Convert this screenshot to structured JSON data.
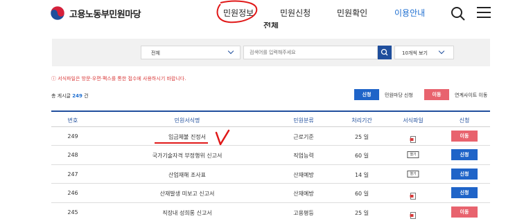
{
  "header": {
    "logo_text": "고용노동부민원마당",
    "nav": [
      {
        "label": "민원정보"
      },
      {
        "label": "민원신청"
      },
      {
        "label": "민원확인"
      },
      {
        "label": "이용안내"
      }
    ],
    "page_title_peek": "전체"
  },
  "search": {
    "scope_value": "전체",
    "placeholder": "검색어를 입력해주세요",
    "count_value": "10개씩 보기"
  },
  "notice": "ⓘ 서식파일은 방문·우편·팩스를 통한 접수에 사용하시기 바랍니다.",
  "total": {
    "prefix": "총 게시글",
    "count": "249",
    "suffix": "건"
  },
  "legend": {
    "apply_btn": "신청",
    "apply_text": "민원마당 신청",
    "move_btn": "이동",
    "move_text": "연계사이트 이동"
  },
  "table": {
    "headers": [
      "번호",
      "민원서식명",
      "민원분류",
      "처리기간",
      "서식파일",
      "신청"
    ],
    "rows": [
      {
        "no": "249",
        "name": "임금체불 진정서",
        "category": "근로기준",
        "period": "25 일",
        "file": "icon",
        "action": "이동",
        "action_type": "red"
      },
      {
        "no": "248",
        "name": "국가기술자격 부정행위 신고서",
        "category": "직업능력",
        "period": "60 일",
        "file": "열기",
        "action": "신청",
        "action_type": "blue"
      },
      {
        "no": "247",
        "name": "산업재해 조사표",
        "category": "산재예방",
        "period": "14 일",
        "file": "열기",
        "action": "신청",
        "action_type": "blue"
      },
      {
        "no": "246",
        "name": "산재발생 미보고 신고서",
        "category": "산재예방",
        "period": "60 일",
        "file": "icon",
        "action": "신청",
        "action_type": "blue"
      },
      {
        "no": "245",
        "name": "직장내 성희롱 신고서",
        "category": "고용평등",
        "period": "25 일",
        "file": "icon",
        "action": "이동",
        "action_type": "red"
      }
    ]
  },
  "annotation": {
    "checkmark": "V"
  },
  "colors": {
    "primary": "#1f4e9c",
    "accent_blue": "#1f6fd1",
    "red_button": "#e8636e",
    "annotation_red": "#e01818"
  }
}
